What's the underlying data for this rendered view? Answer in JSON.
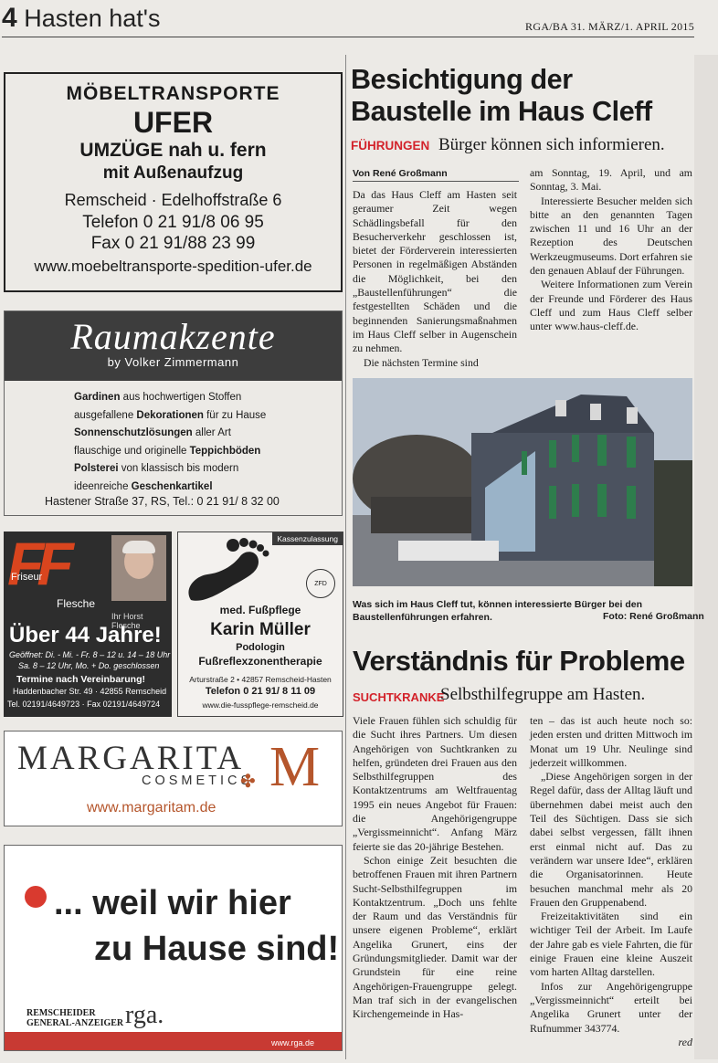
{
  "header": {
    "page_number": "4",
    "section": "Hasten hat's",
    "edition": "RGA/BA 31. MÄRZ/1. APRIL 2015"
  },
  "ad_ufer": {
    "line1": "MÖBELTRANSPORTE",
    "line2": "UFER",
    "line3": "UMZÜGE nah u. fern",
    "line4": "mit Außenaufzug",
    "address": "Remscheid · Edelhoffstraße 6",
    "phone": "Telefon 0 21 91/8 06 95",
    "fax": "Fax 0 21 91/88 23 99",
    "web": "www.moebeltransporte-spedition-ufer.de"
  },
  "ad_raum": {
    "brand": "Raumakzente",
    "byline": "by Volker Zimmermann",
    "lines": [
      {
        "bold": "Gardinen",
        "rest": " aus hochwertigen Stoffen"
      },
      {
        "pre": "ausgefallene ",
        "bold": "Dekorationen",
        "rest": " für zu Hause"
      },
      {
        "bold": "Sonnenschutzlösungen",
        "rest": " aller Art"
      },
      {
        "pre": "flauschige und originelle ",
        "bold": "Teppichböden",
        "rest": ""
      },
      {
        "bold": "Polsterei",
        "rest": " von klassisch bis modern"
      },
      {
        "pre": "ideenreiche ",
        "bold": "Geschenkartikel",
        "rest": ""
      }
    ],
    "address": "Hastener Straße 37, RS, Tel.: 0 21 91/ 8 32 00"
  },
  "ad_friseur": {
    "logo": "FF",
    "friseur": "Friseur",
    "name": "Flesche",
    "photo_caption": "Ihr Horst Flesche",
    "headline": "Über 44 Jahre!",
    "hours1": "Geöffnet: Di. - Mi. - Fr. 8 – 12 u. 14 – 18 Uhr",
    "hours2": "Sa. 8 – 12 Uhr, Mo. + Do. geschlossen",
    "appointment": "Termine nach Vereinbarung!",
    "address": "Haddenbacher Str. 49 · 42855 Remscheid",
    "tel": "Tel. 02191/4649723 · Fax 02191/4649724"
  },
  "ad_fuss": {
    "tag": "Kassenzulassung",
    "seal": "ZFD",
    "med": "med. Fußpflege",
    "name": "Karin Müller",
    "podologin": "Podologin",
    "therapie": "Fußreflexzonentherapie",
    "address": "Arturstraße 2 • 42857 Remscheid-Hasten",
    "tel": "Telefon 0 21 91/ 8 11 09",
    "web": "www.die-fusspflege-remscheid.de"
  },
  "ad_margarita": {
    "name": "MARGARITA",
    "cosmetics": "COSMETICS",
    "monogram": "M",
    "web": "www.margaritam.de"
  },
  "ad_rga": {
    "line1": "... weil wir hier",
    "line2": "zu Hause sind!",
    "publisher1": "REMSCHEIDER",
    "publisher2": "GENERAL-ANZEIGER",
    "logo": "rga.",
    "web": "www.rga.de"
  },
  "article1": {
    "headline": "Besichtigung der Baustelle im Haus Cleff",
    "kicker": "FÜHRUNGEN",
    "subhead": "Bürger können sich informieren.",
    "author": "Von René Großmann",
    "col1": [
      "Da das Haus Cleff am Hasten seit geraumer Zeit wegen Schädlingsbefall für den Besucherverkehr geschlossen ist, bietet der Förderverein interessierten Personen in regelmäßigen Abständen die Möglichkeit, bei den „Baustellenführungen“ die festgestellten Schäden und die beginnenden Sanierungsmaßnahmen im Haus Cleff selber in Augenschein zu nehmen.",
      "Die nächsten Termine sind"
    ],
    "col2": [
      "am Sonntag, 19. April, und am Sonntag, 3. Mai.",
      "Interessierte Besucher melden sich bitte an den genannten Tagen zwischen 11 und 16 Uhr an der Rezeption des Deutschen Werkzeugmuseums. Dort erfahren sie den genauen Ablauf der Führungen.",
      "Weitere Informationen zum Verein der Freunde und Förderer des Haus Cleff und zum Haus Cleff selber unter www.haus-cleff.de."
    ],
    "caption": "Was sich im Haus Cleff tut, können interessierte Bürger bei den Baustellenführungen erfahren.",
    "credit": "Foto: René Großmann"
  },
  "article2": {
    "headline": "Verständnis für Probleme",
    "kicker": "SUCHTKRANKE",
    "subhead": "Selbsthilfegruppe am Hasten.",
    "col1": [
      "Viele Frauen fühlen sich schuldig für die Sucht ihres Partners. Um diesen Angehörigen von Suchtkranken zu helfen, gründeten drei Frauen aus den Selbsthilfegruppen des Kontaktzentrums am Weltfrauentag 1995 ein neues Angebot für Frauen: die Angehörigengruppe „Vergissmeinnicht“. Anfang März feierte sie das 20-jährige Bestehen.",
      "Schon einige Zeit besuchten die betroffenen Frauen mit ihren Partnern Sucht-Selbsthilfegruppen im Kontaktzentrum. „Doch uns fehlte der Raum und das Verständnis für unsere eigenen Probleme“, erklärt Angelika Grunert, eins der Gründungsmitglieder. Damit war der Grundstein für eine reine Angehörigen-Frauengruppe gelegt. Man traf sich in der evangelischen Kirchengemeinde in Has-"
    ],
    "col2": [
      "ten – das ist auch heute noch so: jeden ersten und dritten Mittwoch im Monat um 19 Uhr. Neulinge sind jederzeit willkommen.",
      "„Diese Angehörigen sorgen in der Regel dafür, dass der Alltag läuft und übernehmen dabei meist auch den Teil des Süchtigen. Dass sie sich dabei selbst vergessen, fällt ihnen erst einmal nicht auf. Das zu verändern war unsere Idee“, erklären die Organisatorinnen. Heute besuchen manchmal mehr als 20 Frauen den Gruppenabend.",
      "Freizeitaktivitäten sind ein wichtiger Teil der Arbeit. Im Laufe der Jahre gab es viele Fahrten, die für einige Frauen eine kleine Auszeit vom harten Alltag darstellen.",
      "Infos zur Angehörigengruppe „Vergissmeinnicht“ erteilt bei Angelika Grunert unter der Rufnummer 343774."
    ],
    "signature": "red"
  },
  "colors": {
    "accent_red": "#d3222a",
    "margarita_copper": "#b5562c",
    "rga_red": "#c83a33",
    "friseur_orange": "#d9451e"
  }
}
